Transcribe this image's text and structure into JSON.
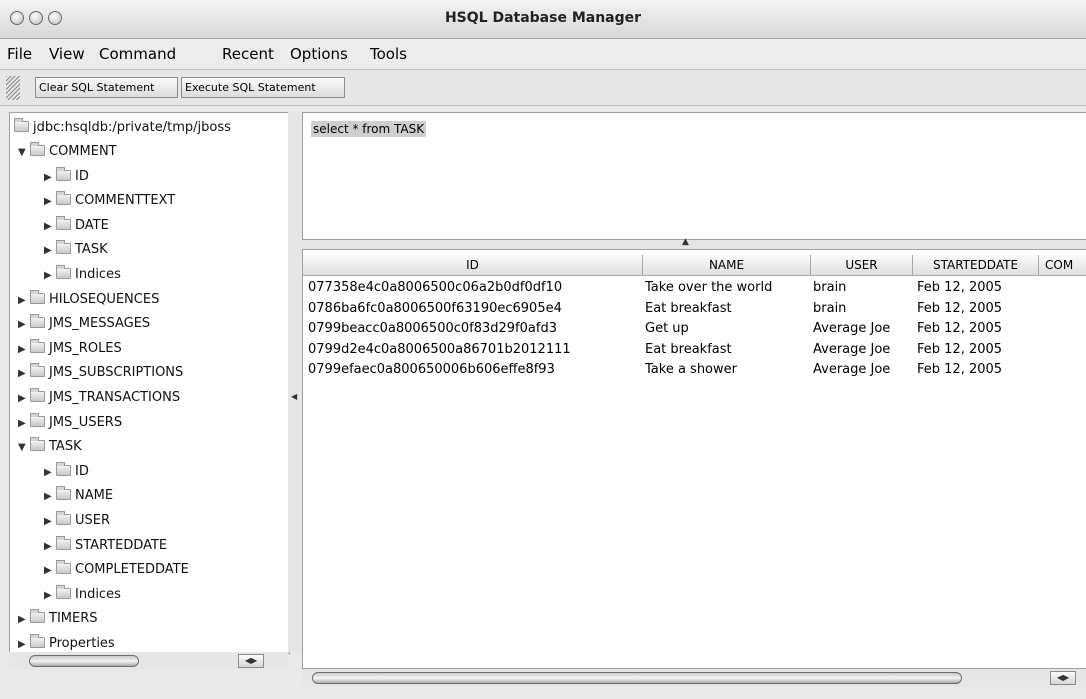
{
  "window": {
    "title": "HSQL Database Manager"
  },
  "menu": [
    "File",
    "View",
    "Command",
    "Recent",
    "Options",
    "Tools"
  ],
  "toolbar": {
    "clear_label": "Clear SQL Statement",
    "execute_label": "Execute SQL Statement"
  },
  "tree": {
    "root": "jdbc:hsqldb:/private/tmp/jboss",
    "nodes": [
      {
        "label": "COMMENT",
        "expanded": true
      },
      {
        "label": "ID",
        "expanded": false
      },
      {
        "label": "COMMENTTEXT",
        "expanded": false
      },
      {
        "label": "DATE",
        "expanded": false
      },
      {
        "label": "TASK",
        "expanded": false
      },
      {
        "label": "Indices",
        "expanded": false
      },
      {
        "label": "HILOSEQUENCES",
        "expanded": false
      },
      {
        "label": "JMS_MESSAGES",
        "expanded": false
      },
      {
        "label": "JMS_ROLES",
        "expanded": false
      },
      {
        "label": "JMS_SUBSCRIPTIONS",
        "expanded": false
      },
      {
        "label": "JMS_TRANSACTIONS",
        "expanded": false
      },
      {
        "label": "JMS_USERS",
        "expanded": false
      },
      {
        "label": "TASK",
        "expanded": true
      },
      {
        "label": "ID",
        "expanded": false
      },
      {
        "label": "NAME",
        "expanded": false
      },
      {
        "label": "USER",
        "expanded": false
      },
      {
        "label": "STARTEDDATE",
        "expanded": false
      },
      {
        "label": "COMPLETEDDATE",
        "expanded": false
      },
      {
        "label": "Indices",
        "expanded": false
      },
      {
        "label": "TIMERS",
        "expanded": false
      },
      {
        "label": "Properties",
        "expanded": false
      }
    ]
  },
  "query": {
    "text": "select * from TASK"
  },
  "results": {
    "columns": [
      "ID",
      "NAME",
      "USER",
      "STARTEDDATE",
      "COM"
    ],
    "rows": [
      [
        "077358e4c0a8006500c06a2b0df0df10",
        "Take over the world",
        "brain",
        "Feb 12, 2005"
      ],
      [
        "0786ba6fc0a8006500f63190ec6905e4",
        "Eat breakfast",
        "brain",
        "Feb 12, 2005"
      ],
      [
        "0799beacc0a8006500c0f83d29f0afd3",
        "Get up",
        "Average Joe",
        "Feb 12, 2005"
      ],
      [
        "0799d2e4c0a8006500a86701b2012111",
        "Eat breakfast",
        "Average Joe",
        "Feb 12, 2005"
      ],
      [
        "0799efaec0a800650006b606effe8f93",
        "Take a shower",
        "Average Joe",
        "Feb 12, 2005"
      ]
    ]
  },
  "icons": {
    "expanded_triangle": "▼",
    "collapsed_triangle": "▶",
    "split_up_arrow": "▲",
    "split_left_arrow": "◀",
    "scroll_arrows": "◀▶"
  }
}
